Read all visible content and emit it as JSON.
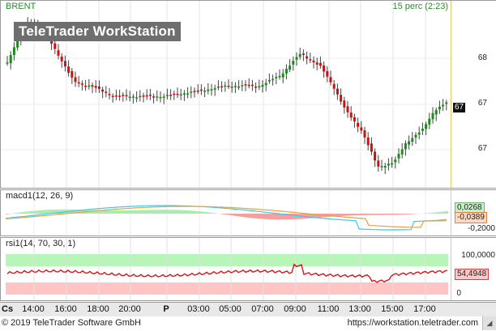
{
  "main": {
    "title": "BRENT",
    "interval": "15 perc (2:23)",
    "watermark_bold": "TeleTrader",
    "watermark_rest": "WorkStation",
    "y_ticks": [
      "68",
      "67",
      "67"
    ],
    "last_price_tag": "67",
    "colors": {
      "up": "#1a8c1a",
      "down": "#cc1111",
      "wick": "#444444"
    }
  },
  "macd": {
    "title": "macd1(12, 26, 9)",
    "value_tag1": "0,0268",
    "value_tag2": "-0,0389",
    "y_ticks": [
      "-0,2000"
    ]
  },
  "rsi": {
    "title": "rsi1(14, 70, 30, 1)",
    "y_ticks": [
      "100,0000",
      "0"
    ],
    "value_tag": "54,4948",
    "upper_band": 70,
    "lower_band": 30
  },
  "xaxis": {
    "cs_label": "Cs",
    "labels": [
      "14:00",
      "16:00",
      "18:00",
      "20:00",
      "P",
      "03:00",
      "05:00",
      "07:00",
      "09:00",
      "11:00",
      "13:00",
      "15:00",
      "17:00"
    ]
  },
  "footer": {
    "copyright": "© 2019 TeleTrader Software GmbH",
    "url": "https://workstation.teletrader.com",
    "corner_glyph": "◢"
  }
}
